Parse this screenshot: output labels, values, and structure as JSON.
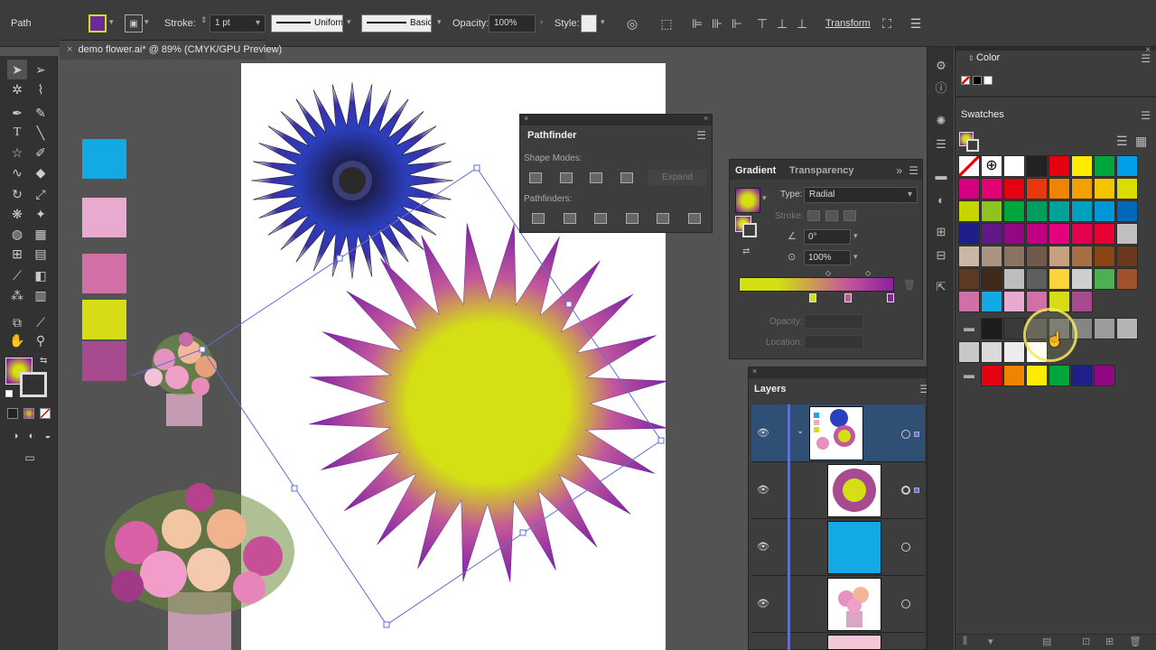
{
  "control_bar": {
    "object_type": "Path",
    "stroke_label": "Stroke:",
    "stroke_value": "1 pt",
    "profile_uniform": "Uniform",
    "brush_basic": "Basic",
    "opacity_label": "Opacity:",
    "opacity_value": "100%",
    "style_label": "Style:",
    "transform_label": "Transform"
  },
  "document": {
    "tab_title": "demo flower.ai* @ 89% (CMYK/GPU Preview)"
  },
  "pathfinder": {
    "title": "Pathfinder",
    "shape_modes_label": "Shape Modes:",
    "pathfinders_label": "Pathfinders:",
    "expand_label": "Expand"
  },
  "gradient": {
    "tab_gradient": "Gradient",
    "tab_transparency": "Transparency",
    "type_label": "Type:",
    "type_value": "Radial",
    "stroke_label": "Stroke:",
    "angle_value": "0°",
    "aspect_value": "100%",
    "opacity_label": "Opacity:",
    "location_label": "Location:",
    "stop_colors": [
      "#d4df14",
      "#c2579a",
      "#8b1fa0"
    ]
  },
  "color_panel": {
    "title": "Color"
  },
  "swatches_panel": {
    "title": "Swatches"
  },
  "layers": {
    "title": "Layers"
  },
  "colors": {
    "accent_blue": "#5f6fcf",
    "star_yellow": "#d4df14",
    "star_purple": "#8b1fa0",
    "flower_blue": "#2b2e9e"
  },
  "left_swatches": [
    "#12a9e5",
    "#e9aad0",
    "#d070a6",
    "#d6dc18",
    "#a84a8f"
  ]
}
